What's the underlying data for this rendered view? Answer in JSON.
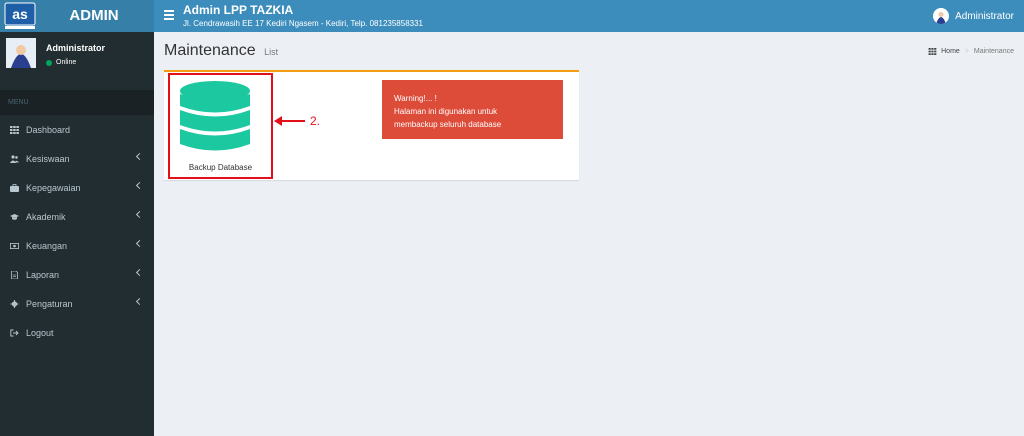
{
  "header": {
    "logo_text": "ADMIN",
    "title": "Admin LPP TAZKIA",
    "address": "Jl. Cendrawasih EE 17 Kediri Ngasem - Kediri, Telp. 081235858331",
    "user_name": "Administrator"
  },
  "sidebar": {
    "user_name": "Administrator",
    "status": "Online",
    "menu_header": "MENU",
    "items": [
      {
        "label": "Dashboard",
        "icon": "dashboard-icon",
        "has_children": false
      },
      {
        "label": "Kesiswaan",
        "icon": "users-icon",
        "has_children": true
      },
      {
        "label": "Kepegawaian",
        "icon": "briefcase-icon",
        "has_children": true
      },
      {
        "label": "Akademik",
        "icon": "graduation-cap-icon",
        "has_children": true
      },
      {
        "label": "Keuangan",
        "icon": "money-icon",
        "has_children": true
      },
      {
        "label": "Laporan",
        "icon": "file-icon",
        "has_children": true
      },
      {
        "label": "Pengaturan",
        "icon": "gear-icon",
        "has_children": true
      },
      {
        "label": "Logout",
        "icon": "sign-out-icon",
        "has_children": false
      }
    ]
  },
  "content": {
    "title": "Maintenance",
    "subtitle": "List",
    "breadcrumb": {
      "home": "Home",
      "current": "Maintenance"
    },
    "backup_label": "Backup Database",
    "step_number": "2.",
    "alert": {
      "title": "Warning!... !",
      "line1": "Halaman ini digunakan untuk",
      "line2": "membackup seluruh database"
    }
  },
  "colors": {
    "navbar": "#3c8dbc",
    "logo_bg": "#367fa9",
    "sidebar": "#222d32",
    "database_icon": "#1bc8a0",
    "alert": "#dd4b39",
    "highlight_box": "#e3101a",
    "box_top_border": "#f39c12"
  }
}
